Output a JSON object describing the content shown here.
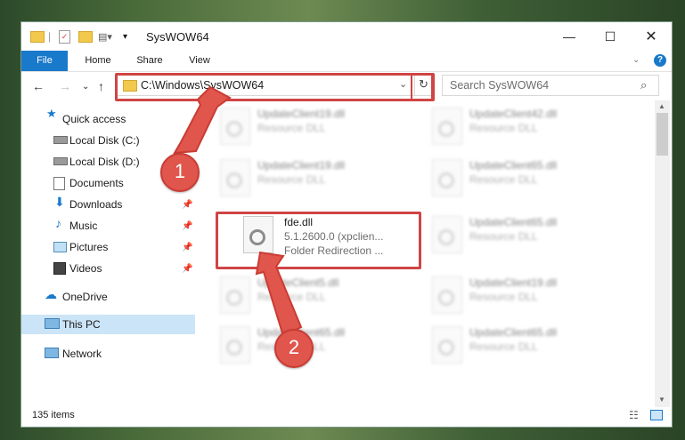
{
  "window": {
    "title": "SysWOW64"
  },
  "ribbon": {
    "tabs": [
      "File",
      "Home",
      "Share",
      "View"
    ]
  },
  "address": {
    "path": "C:\\Windows\\SysWOW64"
  },
  "search": {
    "placeholder": "Search SysWOW64"
  },
  "sidebar": {
    "items": [
      {
        "label": "Quick access",
        "pinned": false
      },
      {
        "label": "Local Disk (C:)",
        "pinned": true
      },
      {
        "label": "Local Disk (D:)",
        "pinned": false
      },
      {
        "label": "Documents",
        "pinned": true
      },
      {
        "label": "Downloads",
        "pinned": true
      },
      {
        "label": "Music",
        "pinned": true
      },
      {
        "label": "Pictures",
        "pinned": true
      },
      {
        "label": "Videos",
        "pinned": true
      },
      {
        "label": "OneDrive",
        "pinned": false
      },
      {
        "label": "This PC",
        "pinned": false
      },
      {
        "label": "Network",
        "pinned": false
      }
    ]
  },
  "files": {
    "highlight": {
      "name": "fde.dll",
      "version": "5.1.2600.0 (xpclien...",
      "description": "Folder Redirection ..."
    },
    "blurred": [
      {
        "name": "UpdateClient19.dll",
        "type": "Resource DLL"
      },
      {
        "name": "UpdateClient42.dll",
        "type": "Resource DLL"
      },
      {
        "name": "UpdateClient19.dll",
        "type": "Resource DLL"
      },
      {
        "name": "UpdateClient65.dll",
        "type": "Resource DLL"
      },
      {
        "name": "UpdateClient65.dll",
        "type": "Resource DLL"
      },
      {
        "name": "UpdateClient5.dll",
        "type": "Resource DLL"
      },
      {
        "name": "UpdateClient19.dll",
        "type": "Resource DLL"
      },
      {
        "name": "UpdateClient65.dll",
        "type": "Resource DLL"
      },
      {
        "name": "UpdateClient65.dll",
        "type": "Resource DLL"
      }
    ]
  },
  "status": {
    "count": "135 items"
  },
  "callouts": {
    "one": "1",
    "two": "2"
  },
  "colors": {
    "accent": "#1979ca",
    "highlight_box": "#d04444",
    "arrow": "#e0554c"
  }
}
